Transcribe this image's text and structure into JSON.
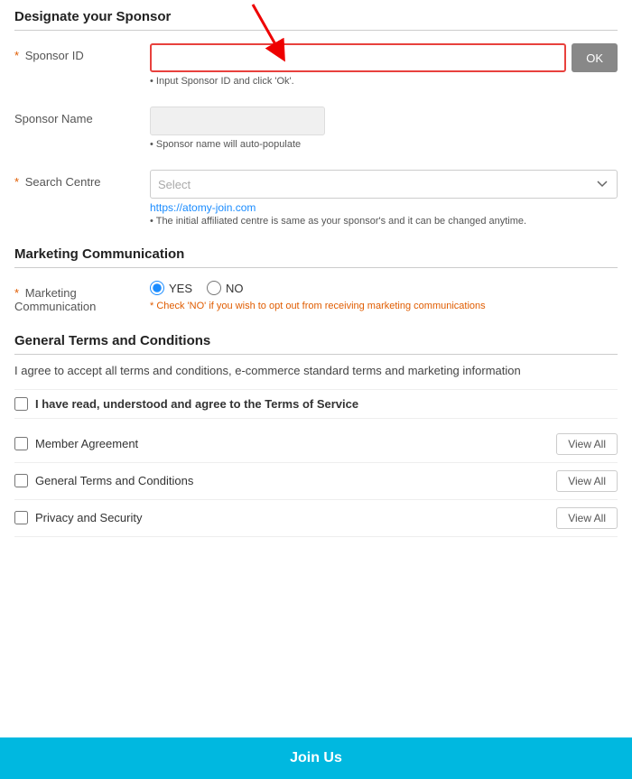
{
  "page": {
    "title": "Designate your Sponsor"
  },
  "sections": {
    "sponsor": {
      "heading": "Designate your Sponsor",
      "sponsor_id": {
        "label": "Sponsor ID",
        "required": true,
        "placeholder": "",
        "ok_button": "OK",
        "hint": "Input Sponsor ID and click 'Ok'."
      },
      "sponsor_name": {
        "label": "Sponsor Name",
        "required": false,
        "placeholder": "",
        "hint": "Sponsor name will auto-populate"
      },
      "search_centre": {
        "label": "Search Centre",
        "required": true,
        "placeholder": "Select",
        "watermark": "https://atomy-join.com",
        "hint": "The initial affiliated centre is same as your sponsor's and it can be changed anytime."
      }
    },
    "marketing": {
      "heading": "Marketing Communication",
      "label": "Marketing Communication",
      "required": true,
      "yes_label": "YES",
      "no_label": "NO",
      "warning": "Check 'NO' if you wish to opt out from receiving marketing communications"
    },
    "terms": {
      "heading": "General Terms and Conditions",
      "description": "I agree to accept all terms and conditions, e-commerce standard terms and marketing information",
      "agree_label": "I have read, understood and agree to the Terms of Service",
      "items": [
        {
          "label": "Member Agreement",
          "view_all": "View All"
        },
        {
          "label": "General Terms and Conditions",
          "view_all": "View All"
        },
        {
          "label": "Privacy and Security",
          "view_all": "View All"
        }
      ]
    },
    "join_us": {
      "button_label": "Join Us"
    }
  }
}
